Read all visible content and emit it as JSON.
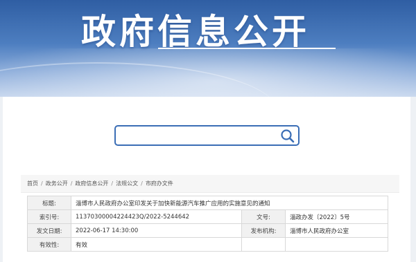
{
  "banner": {
    "title": "政府信息公开"
  },
  "search": {
    "value": "",
    "placeholder": ""
  },
  "breadcrumb": [
    "首页",
    "政务公开",
    "政府信息公开",
    "法规公文",
    "市府办文件"
  ],
  "meta": {
    "title_label": "标题:",
    "title_value": "淄博市人民政府办公室印发关于加快新能源汽车推广应用的实施意见的通知",
    "index_label": "索引号:",
    "index_value": "11370300004224423Q/2022-5244642",
    "docno_label": "文号:",
    "docno_value": "淄政办发〔2022〕5号",
    "date_label": "发文日期:",
    "date_value": "2022-06-17 14:30:00",
    "org_label": "发布机构:",
    "org_value": "淄博市人民政府办公室",
    "valid_label": "有效性:",
    "valid_value": "有效"
  },
  "colors": {
    "accent": "#3a6db5",
    "banner_top": "#2f5ea3",
    "label_bg": "#f1f1f1"
  }
}
